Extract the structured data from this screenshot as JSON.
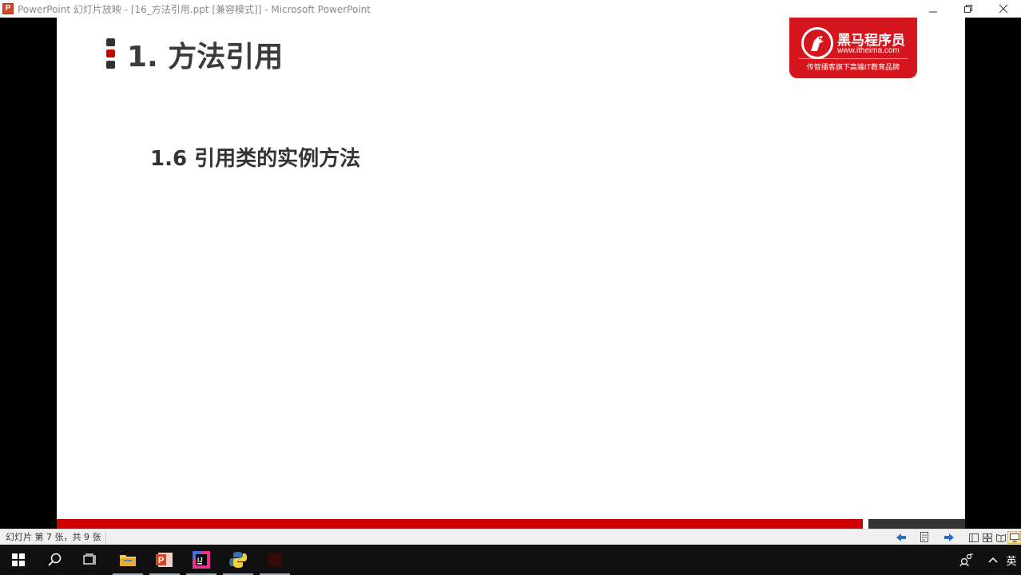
{
  "window": {
    "title": "PowerPoint 幻灯片放映 - [16_方法引用.ppt [兼容模式]] - Microsoft PowerPoint",
    "app_icon_letter": "P"
  },
  "slide": {
    "title": "1. 方法引用",
    "subtitle": "1.6 引用类的实例方法",
    "logo": {
      "name": "黑马程序员",
      "url": "www.itheima.com",
      "slogan": "传智播客旗下高端IT教育品牌"
    },
    "colors": {
      "accent_red": "#cc0000",
      "dark_gray": "#333333",
      "bullet_red": "#cc0000",
      "bullet_dark": "#333333"
    }
  },
  "statusbar": {
    "slide_counter": "幻灯片 第 7 张，共 9 张"
  },
  "taskbar": {
    "ime_label": "英"
  }
}
